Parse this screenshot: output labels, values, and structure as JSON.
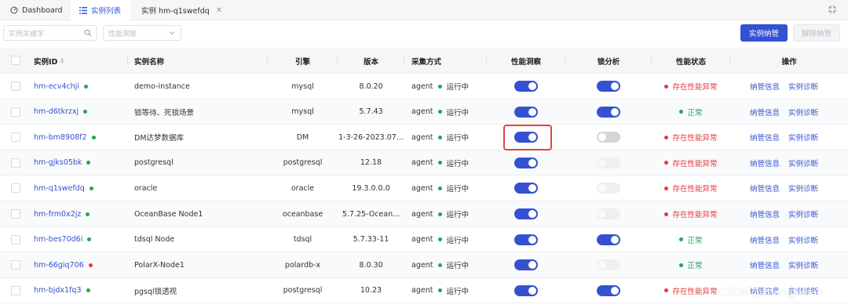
{
  "tabs": [
    {
      "label": "Dashboard",
      "icon": "dashboard-icon",
      "active": false
    },
    {
      "label": "实例列表",
      "icon": "list-icon",
      "active": true
    },
    {
      "label": "实例 hm-q1swefdq",
      "icon": "",
      "active": false,
      "closable": true
    }
  ],
  "filters": {
    "keyword_placeholder": "实例关键字",
    "insight_placeholder": "性能洞察"
  },
  "buttons": {
    "manage": "实例纳管",
    "unmanage": "解除纳管"
  },
  "columns": [
    "实例ID",
    "实例名称",
    "引擎",
    "版本",
    "采集方式",
    "性能洞察",
    "锁分析",
    "性能状态",
    "操作"
  ],
  "actions": {
    "info": "纳管信息",
    "diagnose": "实例诊断"
  },
  "rows": [
    {
      "id": "hm-ecv4chji",
      "id_status": "green",
      "name": "demo-instance",
      "engine": "mysql",
      "version": "8.0.20",
      "collect": "agent",
      "run_status": "运行中",
      "insight": "on",
      "lock": "on",
      "perf": "存在性能异常",
      "perf_level": "bad"
    },
    {
      "id": "hm-d6tkrzxj",
      "id_status": "green",
      "name": "锁等待、死锁场景",
      "engine": "mysql",
      "version": "5.7.43",
      "collect": "agent",
      "run_status": "运行中",
      "insight": "on",
      "lock": "on",
      "perf": "正常",
      "perf_level": "ok"
    },
    {
      "id": "hm-bm8908f2",
      "id_status": "green",
      "name": "DM达梦数据库",
      "engine": "DM",
      "version": "1-3-26-2023.07...",
      "collect": "agent",
      "run_status": "运行中",
      "insight": "on",
      "lock": "off",
      "perf": "存在性能异常",
      "perf_level": "bad"
    },
    {
      "id": "hm-gjks05bk",
      "id_status": "green",
      "name": "postgresql",
      "engine": "postgresql",
      "version": "12.18",
      "collect": "agent",
      "run_status": "运行中",
      "insight": "on",
      "lock": "disabled",
      "perf": "存在性能异常",
      "perf_level": "bad"
    },
    {
      "id": "hm-q1swefdq",
      "id_status": "green",
      "name": "oracle",
      "engine": "oracle",
      "version": "19.3.0.0.0",
      "collect": "agent",
      "run_status": "运行中",
      "insight": "on",
      "lock": "disabled",
      "perf": "存在性能异常",
      "perf_level": "bad"
    },
    {
      "id": "hm-frm0x2jz",
      "id_status": "green",
      "name": "OceanBase Node1",
      "engine": "oceanbase",
      "version": "5.7.25-Ocean...",
      "collect": "agent",
      "run_status": "运行中",
      "insight": "on",
      "lock": "disabled",
      "perf": "存在性能异常",
      "perf_level": "bad"
    },
    {
      "id": "hm-bes70d6i",
      "id_status": "green",
      "name": "tdsql Node",
      "engine": "tdsql",
      "version": "5.7.33-11",
      "collect": "agent",
      "run_status": "运行中",
      "insight": "on",
      "lock": "on",
      "perf": "正常",
      "perf_level": "ok"
    },
    {
      "id": "hm-66giq706",
      "id_status": "red",
      "name": "PolarX-Node1",
      "engine": "polardb-x",
      "version": "8.0.30",
      "collect": "agent",
      "run_status": "运行中",
      "insight": "on",
      "lock": "disabled",
      "perf": "正常",
      "perf_level": "ok"
    },
    {
      "id": "hm-bjdx1fq3",
      "id_status": "green",
      "name": "pgsql锁透视",
      "engine": "postgresql",
      "version": "10.23",
      "collect": "agent",
      "run_status": "运行中",
      "insight": "on",
      "lock": "on",
      "perf": "存在性能异常",
      "perf_level": "bad"
    }
  ],
  "colors": {
    "primary": "#3451d1",
    "ok": "#22a45d",
    "bad": "#e5393a",
    "highlight": "#e2463e"
  },
  "watermark": "CSDN @zhangjikuan"
}
